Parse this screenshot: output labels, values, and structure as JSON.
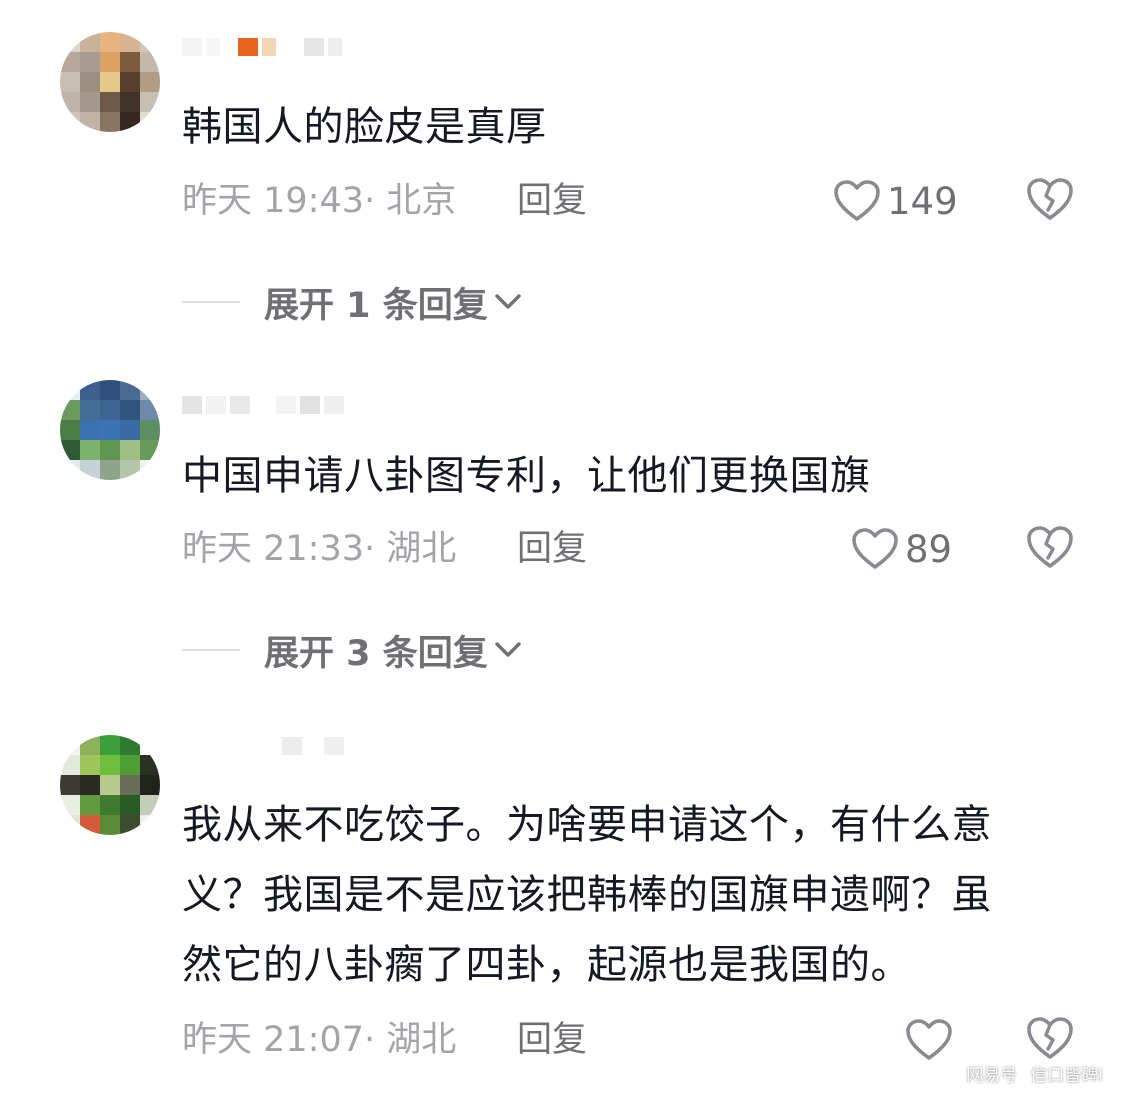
{
  "comments": [
    {
      "text": "韩国人的脸皮是真厚",
      "time": "昨天 19:43",
      "location": "北京",
      "reply_label": "回复",
      "likes": "149",
      "expand_label": "展开 1 条回复"
    },
    {
      "text": "中国申请八卦图专利，让他们更换国旗",
      "time": "昨天 21:33",
      "location": "湖北",
      "reply_label": "回复",
      "likes": "89",
      "expand_label": "展开 3 条回复"
    },
    {
      "text": "我从来不吃饺子。为啥要申请这个，有什么意\n义？我国是不是应该把韩棒的国旗申遗啊？虽\n然它的八卦瘸了四卦，起源也是我国的。",
      "time": "昨天 21:07",
      "location": "湖北",
      "reply_label": "回复",
      "likes": ""
    }
  ],
  "watermark": {
    "brand": "网易号",
    "account": "信口皆碑i"
  },
  "colors": {
    "text": "#161823",
    "meta": "#a3a4a8",
    "action": "#6f7074"
  }
}
